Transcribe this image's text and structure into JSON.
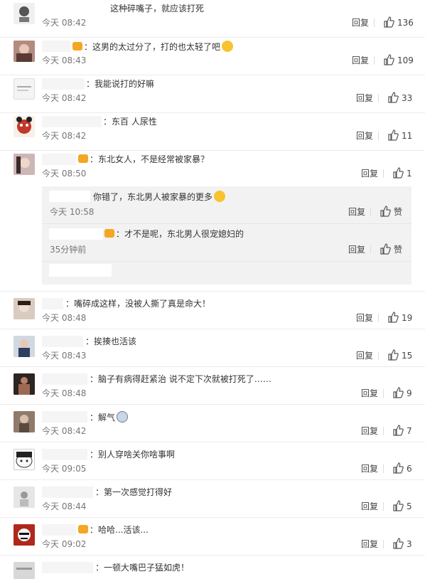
{
  "comments": [
    {
      "text": "这种碎嘴子，就应该打死",
      "time": "今天 08:42",
      "reply": "回复",
      "likes": "136"
    },
    {
      "text": "：这男的太过分了，打的也太轻了吧",
      "time": "今天 08:43",
      "reply": "回复",
      "likes": "109"
    },
    {
      "text": "：我能说打的好嘛",
      "time": "今天 08:42",
      "reply": "回复",
      "likes": "33"
    },
    {
      "text": "：东百 人尿性",
      "time": "今天 08:42",
      "reply": "回复",
      "likes": "11"
    },
    {
      "text": "：东北女人，不是经常被家暴？",
      "time": "今天 08:50",
      "reply": "回复",
      "likes": "1"
    },
    {
      "text": "：嘴碎成这样，没被人撕了真是命大！",
      "time": "今天 08:48",
      "reply": "回复",
      "likes": "19"
    },
    {
      "text": "：挨揍也活该",
      "time": "今天 08:43",
      "reply": "回复",
      "likes": "15"
    },
    {
      "text": "：脑子有病得赶紧治 说不定下次就被打死了……",
      "time": "今天 08:48",
      "reply": "回复",
      "likes": "9"
    },
    {
      "text": "：解气",
      "time": "今天 08:42",
      "reply": "回复",
      "likes": "7"
    },
    {
      "text": "：别人穿啥关你啥事啊",
      "time": "今天 09:05",
      "reply": "回复",
      "likes": "6"
    },
    {
      "text": "：第一次感觉打得好",
      "time": "今天 08:44",
      "reply": "回复",
      "likes": "5"
    },
    {
      "text": "：哈哈...活该...",
      "time": "今天 09:02",
      "reply": "回复",
      "likes": "3"
    },
    {
      "text": "：一顿大嘴巴子猛如虎！"
    }
  ],
  "replies": [
    {
      "text": "你错了，东北男人被家暴的更多",
      "time": "今天 10:58",
      "reply": "回复",
      "likes": "赞"
    },
    {
      "text": "：才不是呢，东北男人很宠媳妇的",
      "time": "35分钟前",
      "reply": "回复",
      "likes": "赞"
    }
  ],
  "colors": {
    "accent": "#f5a623",
    "link": "#eb7350",
    "meta": "#777777",
    "sub_bg": "#f2f2f2"
  }
}
